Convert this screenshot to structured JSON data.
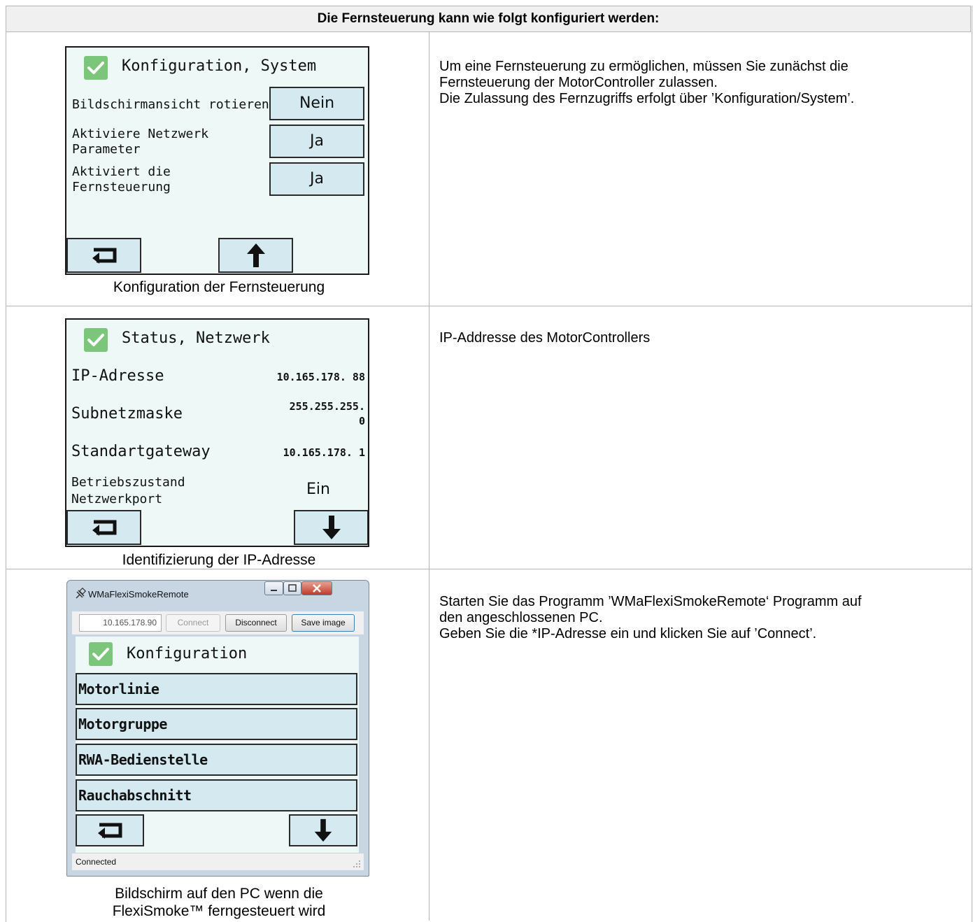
{
  "header": "Die Fernsteuerung kann wie folgt konfiguriert werden:",
  "row1": {
    "screen": {
      "title": "Konfiguration, System",
      "settings": [
        {
          "label": "Bildschirmansicht rotieren",
          "value": "Nein"
        },
        {
          "label": "Aktiviere Netzwerk Parameter",
          "value": "Ja"
        },
        {
          "label": "Aktiviert die Fernsteuerung",
          "value": "Ja"
        }
      ],
      "icons": [
        "return-arrow-icon",
        "arrow-up-icon"
      ]
    },
    "caption": "Konfiguration der Fernsteuerung",
    "description": [
      "Um eine Fernsteuerung zu ermöglichen, müssen Sie zunächst die",
      "Fernsteuerung der MotorController zulassen.",
      "Die Zulassung des Fernzugriffs erfolgt über ’Konfiguration/System’."
    ]
  },
  "row2": {
    "screen": {
      "title": "Status, Netzwerk",
      "fields": [
        {
          "label": "IP-Adresse",
          "value": "10.165.178. 88"
        },
        {
          "label": "Subnetzmaske",
          "value_line1": "255.255.255.",
          "value_line2": "0"
        },
        {
          "label": "Standartgateway",
          "value": "10.165.178. 1"
        },
        {
          "label_line1": "Betriebszustand",
          "label_line2": "Netzwerkport",
          "value": "Ein"
        }
      ],
      "icons": [
        "return-arrow-icon",
        "arrow-down-icon"
      ]
    },
    "caption": "Identifizierung der IP-Adresse",
    "description": [
      "IP-Addresse des MotorControllers"
    ]
  },
  "row3": {
    "window": {
      "title": "WMaFlexiSmokeRemote",
      "ip_value": "10.165.178.90",
      "buttons": [
        "Connect",
        "Disconnect",
        "Save image"
      ],
      "screen_title": "Konfiguration",
      "menu_items": [
        "Motorlinie",
        "Motorgruppe",
        "RWA-Bedienstelle",
        "Rauchabschnitt"
      ],
      "status": "Connected"
    },
    "caption_line1": "Bildschirm auf den PC wenn die",
    "caption_line2": "FlexiSmoke™ ferngesteuert wird",
    "description": [
      "Starten Sie das Programm ’WMaFlexiSmokeRemote‘ Programm auf",
      "den angeschlossenen PC.",
      "Geben Sie die *IP-Adresse ein und klicken Sie auf ’Connect’."
    ]
  }
}
